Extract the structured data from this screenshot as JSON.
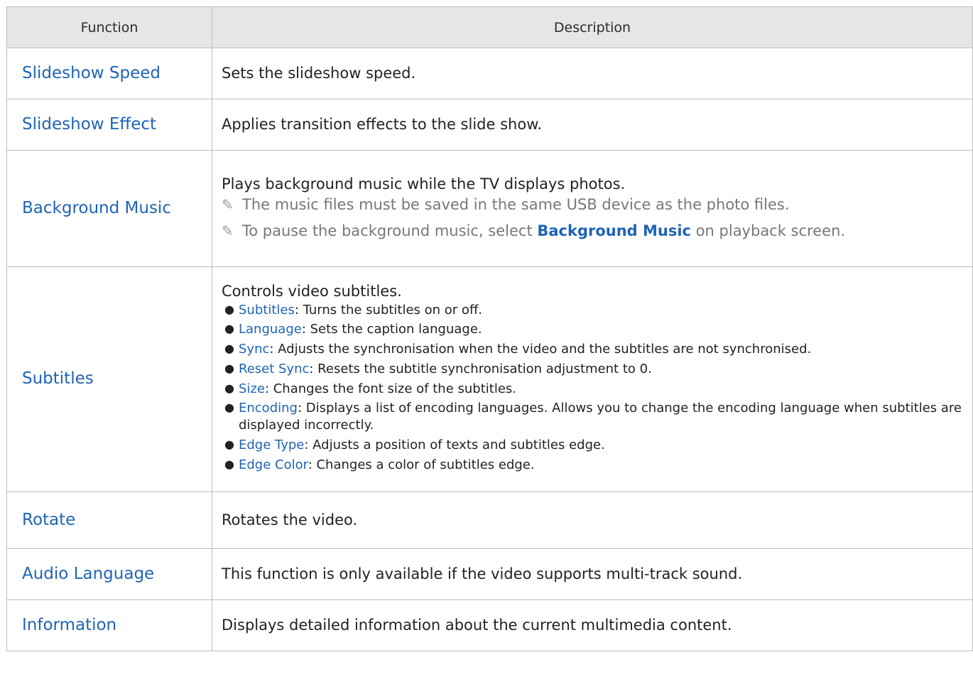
{
  "header": {
    "function": "Function",
    "description": "Description"
  },
  "rows": [
    {
      "function": "Slideshow Speed",
      "description": "Sets the slideshow speed."
    },
    {
      "function": "Slideshow Effect",
      "description": "Applies transition effects to the slide show."
    },
    {
      "function": "Background Music",
      "description": "Plays background music while the TV displays photos.",
      "notes": [
        {
          "text": "The music files must be saved in the same USB device as the photo files."
        },
        {
          "before": "To pause the background music, select ",
          "highlight": "Background Music",
          "after": " on playback screen."
        }
      ]
    },
    {
      "function": "Subtitles",
      "description": "Controls video subtitles.",
      "items": [
        {
          "key": "Subtitles",
          "text": ": Turns the subtitles on or off."
        },
        {
          "key": "Language",
          "text": ": Sets the caption language."
        },
        {
          "key": "Sync",
          "text": ": Adjusts the synchronisation when the video and the subtitles are not synchronised."
        },
        {
          "key": "Reset Sync",
          "text": ": Resets the subtitle synchronisation adjustment to 0."
        },
        {
          "key": "Size",
          "text": ": Changes the font size of the subtitles."
        },
        {
          "key": "Encoding",
          "text": ": Displays a list of encoding languages. Allows you to change the encoding language when subtitles are displayed incorrectly."
        },
        {
          "key": "Edge Type",
          "text": ": Adjusts a position of texts and subtitles edge."
        },
        {
          "key": "Edge Color",
          "text": ": Changes a color of subtitles edge."
        }
      ]
    },
    {
      "function": "Rotate",
      "description": "Rotates the video."
    },
    {
      "function": "Audio Language",
      "description": "This function is only available if the video supports multi-track sound."
    },
    {
      "function": "Information",
      "description": "Displays detailed information about the current multimedia content."
    }
  ],
  "icons": {
    "note": "pencil-icon"
  },
  "colors": {
    "accent": "#1f64b5",
    "header_bg": "#e6e6e6",
    "border": "#bdbdbd",
    "note_text": "#777777"
  }
}
